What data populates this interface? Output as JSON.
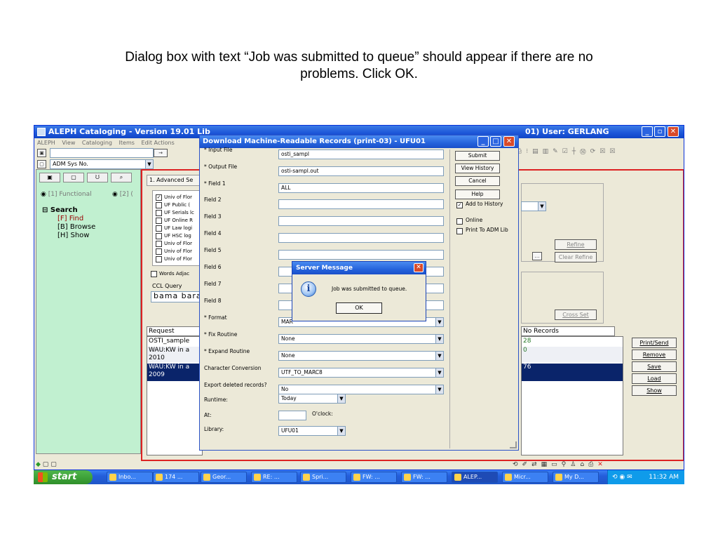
{
  "caption": {
    "line1": "Dialog box with text “Job was submitted to queue” should appear if there are no",
    "line2": "problems.  Click OK."
  },
  "window": {
    "title": "ALEPH Cataloging - Version 19.01  Lib",
    "title_right": "01)  User:  GERLANG",
    "menu": [
      "ALEPH",
      "View",
      "Cataloging",
      "Items",
      "Edit Actions"
    ],
    "base_select": "ADM Sys No."
  },
  "left_panel": {
    "radio1": "[1] Functional",
    "radio2": "[2] (",
    "tree_root": "Search",
    "tree_items": [
      "[F] Find",
      "[B] Browse",
      "[H] Show"
    ]
  },
  "search_panel": {
    "tab_label": "1. Advanced Se",
    "databases": [
      "Univ of Flor",
      "UF Public (",
      "UF Serials lc",
      "UF Online R",
      "UF Law logi",
      "UF HSC log",
      "Univ of Flor",
      "Univ of Flor",
      "Univ of Flor"
    ],
    "words_adjacent": "Words Adjac",
    "ccl_label": "CCL Query",
    "ccl_value": "bama bara",
    "refine": "Refine",
    "clear_refine": "Clear Refine",
    "cross_set": "Cross Set"
  },
  "results_grid": {
    "header_request": "Request",
    "header_no_records": "No Records",
    "rows": [
      {
        "request": "OSTI_sample",
        "count": "28"
      },
      {
        "request": "WAU:KW in a",
        "request2": "2010",
        "count": "0"
      },
      {
        "request": "WAU:KW in a",
        "request2": "2009",
        "count": "76"
      }
    ],
    "buttons": [
      "Print/Send",
      "Remove",
      "Save",
      "Load",
      "Show"
    ]
  },
  "download_dialog": {
    "title": "Download Machine-Readable Records (print-03) - UFU01",
    "fields": [
      {
        "label": "* Input File",
        "value": "osti_sampl"
      },
      {
        "label": "* Output File",
        "value": "osti-sampl.out"
      },
      {
        "label": "* Field 1",
        "value": "ALL"
      },
      {
        "label": "Field 2",
        "value": ""
      },
      {
        "label": "Field 3",
        "value": ""
      },
      {
        "label": "Field 4",
        "value": ""
      },
      {
        "label": "Field 5",
        "value": ""
      },
      {
        "label": "Field 6",
        "value": ""
      },
      {
        "label": "Field 7",
        "value": ""
      },
      {
        "label": "Field 8",
        "value": ""
      },
      {
        "label": "* Format",
        "value": "MAR"
      },
      {
        "label": "* Fix Routine",
        "value": "None"
      },
      {
        "label": "* Expand Routine",
        "value": "None"
      },
      {
        "label": "Character Conversion",
        "value": "UTF_TO_MARC8"
      },
      {
        "label": "Export deleted records?",
        "value": "No"
      }
    ],
    "runtime_label": "Runtime:",
    "runtime_value": "Today",
    "at_label": "At:",
    "oclock_label": "O'clock:",
    "library_label": "Library:",
    "library_value": "UFU01",
    "buttons": {
      "submit": "Submit",
      "view_history": "View History",
      "cancel": "Cancel",
      "help": "Help"
    },
    "checks": {
      "add_to_history": "Add to History",
      "online": "Online",
      "print_to_adm": "Print To ADM Lib"
    }
  },
  "server_message": {
    "title": "Server Message",
    "text": "Job was submitted to queue.",
    "ok": "OK"
  },
  "taskbar": {
    "start": "start",
    "tasks": [
      "Inbo...",
      "174 ...",
      "Geor...",
      "RE: ...",
      "Spri...",
      "FW: ...",
      "FW: ...",
      "ALEP...",
      "Micr...",
      "My D..."
    ],
    "clock": "11:32 AM"
  }
}
